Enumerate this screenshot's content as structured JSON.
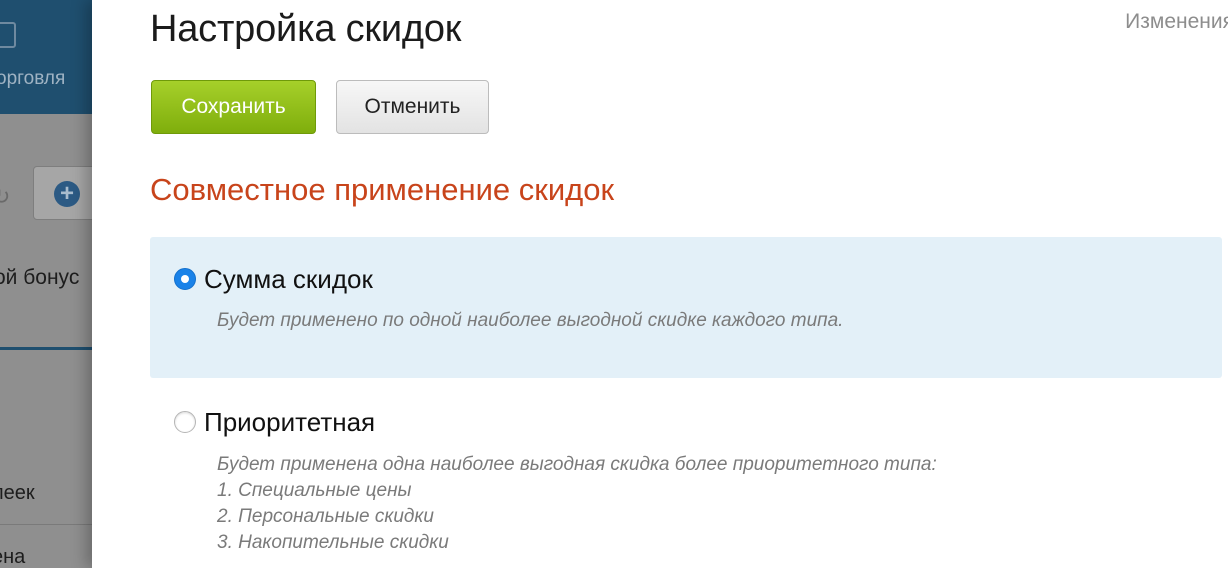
{
  "background": {
    "nav_label": "орговля",
    "bonus_text": "ой бонус",
    "row1": "леек",
    "row2": "ена"
  },
  "panel": {
    "title": "Настройка скидок",
    "history_link": "Изменения",
    "save_label": "Сохранить",
    "cancel_label": "Отменить",
    "section_title": "Совместное применение скидок",
    "options": [
      {
        "label": "Сумма скидок",
        "selected": true,
        "description": [
          "Будет применено по одной наиболее выгодной скидке каждого типа."
        ]
      },
      {
        "label": "Приоритетная",
        "selected": false,
        "description": [
          "Будет применена одна наиболее выгодная скидка более приоритетного типа:",
          "1. Специальные цены",
          "2. Персональные скидки",
          "3. Накопительные скидки"
        ]
      }
    ]
  },
  "colors": {
    "accent_green": "#8fbf14",
    "section_title": "#c8441b",
    "selected_bg": "#e3f0f8",
    "radio_blue": "#1a82e8",
    "header_dark": "#1f4f6f"
  }
}
